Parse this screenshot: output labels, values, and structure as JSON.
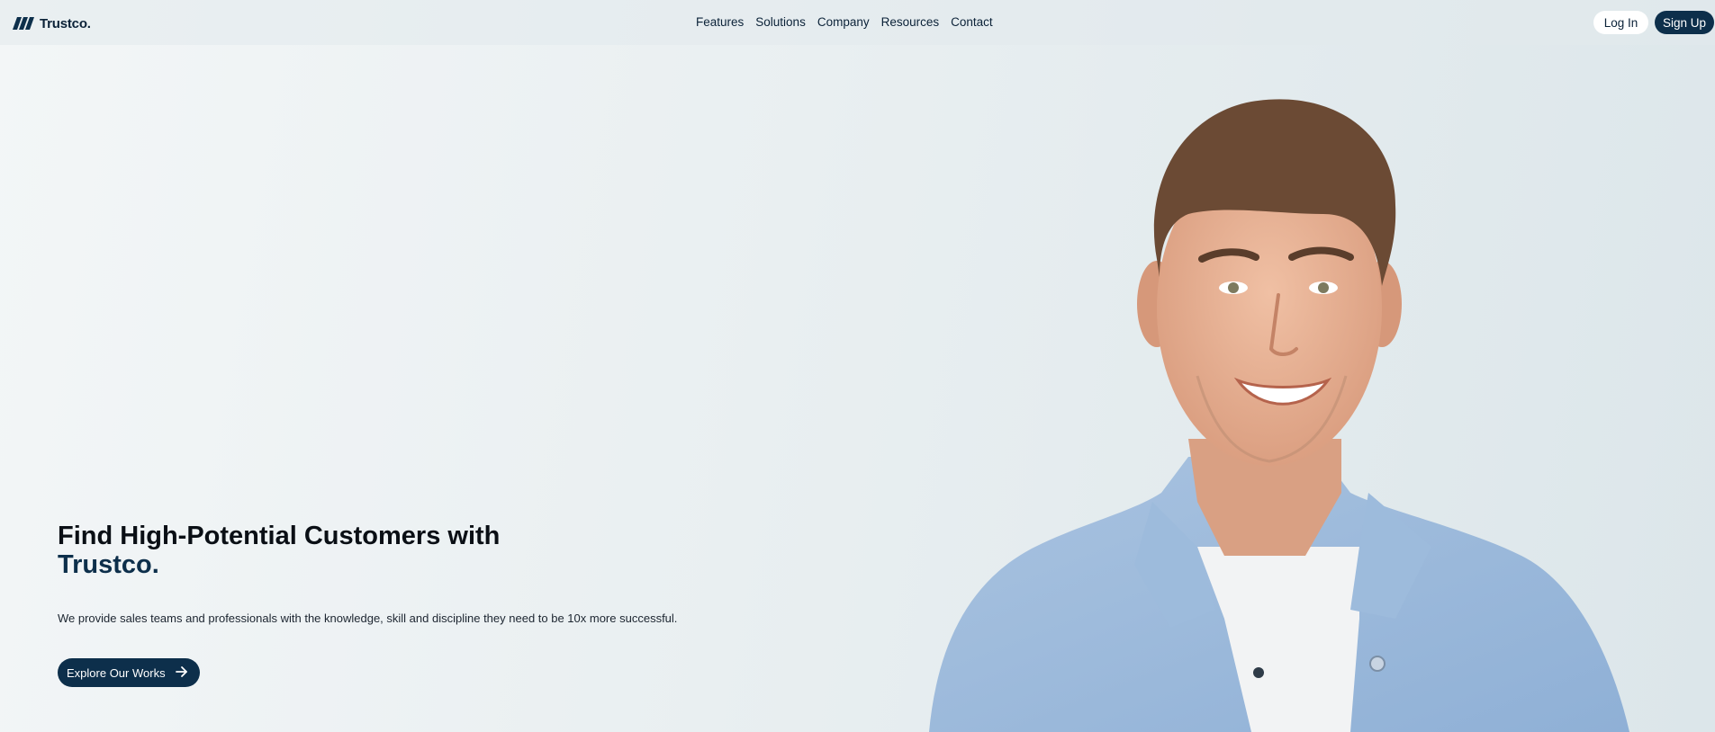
{
  "brand": {
    "name": "Trustco.",
    "logo_icon": "three-slash-stripes-icon"
  },
  "nav": {
    "links": [
      "Features",
      "Solutions",
      "Company",
      "Resources",
      "Contact"
    ],
    "login_label": "Log In",
    "signup_label": "Sign Up"
  },
  "hero": {
    "title_line1": "Find High-Potential Customers with",
    "title_brand": "Trustco.",
    "description": "We provide sales teams and professionals with the knowledge, skill and discipline they need to be 10x more successful.",
    "cta_label": "Explore Our Works",
    "cta_icon": "arrow-right-icon",
    "image_subject": "smiling-man-denim-shirt"
  },
  "colors": {
    "primary": "#0d2f4b",
    "background_start": "#f3f6f7",
    "background_end": "#dce6ea",
    "text": "#0a0f15"
  }
}
